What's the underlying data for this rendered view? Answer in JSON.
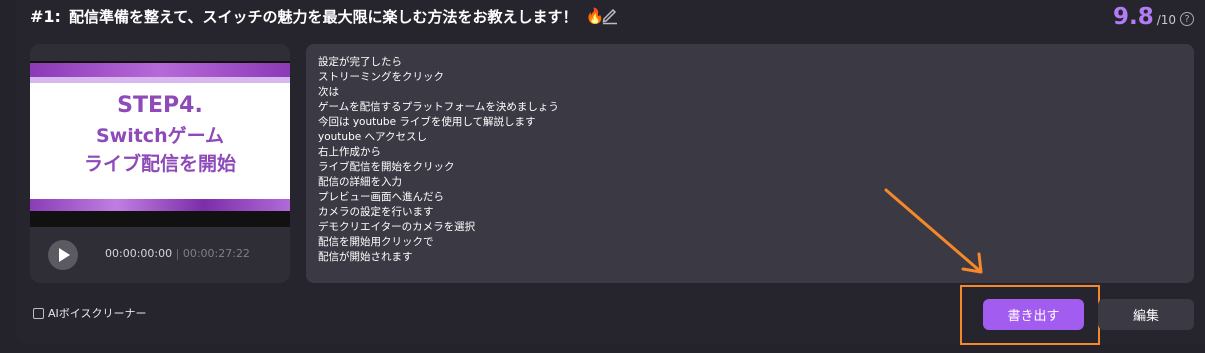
{
  "header": {
    "number": "#1:",
    "title": "配信準備を整えて、スイッチの魅力を最大限に楽しむ方法をお教えします！",
    "emoji": "🔥",
    "score": "9.8",
    "score_max": "/10",
    "help_symbol": "?"
  },
  "player": {
    "thumbnail_lines": [
      "STEP4.",
      "Switchゲーム",
      "ライブ配信を開始"
    ],
    "current_time": "00:00:00:00",
    "separator": "|",
    "duration": "00:00:27:22"
  },
  "script": {
    "lines": [
      "設定が完了したら",
      "ストリーミングをクリック",
      "次は",
      "ゲームを配信するプラットフォームを決めましょう",
      "今回は youtube ライブを使用して解説します",
      "youtube へアクセスし",
      "右上作成から",
      "ライブ配信を開始をクリック",
      "配信の詳細を入力",
      "プレビュー画面へ進んだら",
      "カメラの設定を行います",
      "デモクリエイターのカメラを選択",
      "配信を開始用クリックで",
      "配信が開始されます"
    ]
  },
  "footer": {
    "checkbox_label": "AIボイスクリーナー",
    "export_label": "書き出す",
    "edit_label": "編集"
  },
  "colors": {
    "accent": "#a35cf0",
    "score": "#b27cf5",
    "highlight": "#f5882a"
  }
}
